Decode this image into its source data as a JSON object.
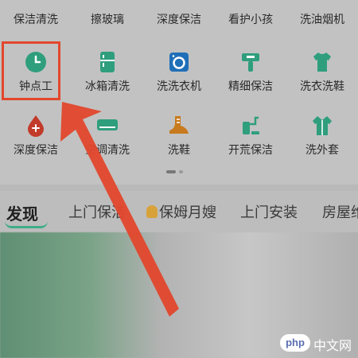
{
  "top_row": [
    "保洁清洗",
    "擦玻璃",
    "深度保洁",
    "看护小孩",
    "洗油烟机"
  ],
  "row1": [
    {
      "label": "钟点工",
      "icon": "clock-icon",
      "color": "#2f9e7d"
    },
    {
      "label": "冰箱清洗",
      "icon": "fridge-icon",
      "color": "#2f9e7d"
    },
    {
      "label": "洗洗衣机",
      "icon": "washing-machine-icon",
      "color": "#1f6fb8"
    },
    {
      "label": "精细保洁",
      "icon": "tool-icon",
      "color": "#2f9e7d"
    },
    {
      "label": "洗衣洗鞋",
      "icon": "shirt-icon",
      "color": "#2f9e7d"
    }
  ],
  "row2": [
    {
      "label": "深度保洁",
      "icon": "drop-plus-icon",
      "color": "#c23a2a"
    },
    {
      "label": "空调清洗",
      "icon": "air-conditioner-icon",
      "color": "#2f9e7d"
    },
    {
      "label": "洗鞋",
      "icon": "shoe-icon",
      "color": "#c87a1e"
    },
    {
      "label": "开荒保洁",
      "icon": "vacuum-icon",
      "color": "#2f9e7d"
    },
    {
      "label": "洗外套",
      "icon": "coat-icon",
      "color": "#2f9e7d"
    }
  ],
  "tabs": {
    "discover": "发现",
    "home_cleaning": "上门保洁",
    "nanny": "保姆月嫂",
    "install": "上门安装",
    "house": "房屋维"
  },
  "watermark": {
    "logo": "php",
    "text": "中文网"
  },
  "colors": {
    "highlight": "#e2472c",
    "arrow": "#e2472c"
  }
}
